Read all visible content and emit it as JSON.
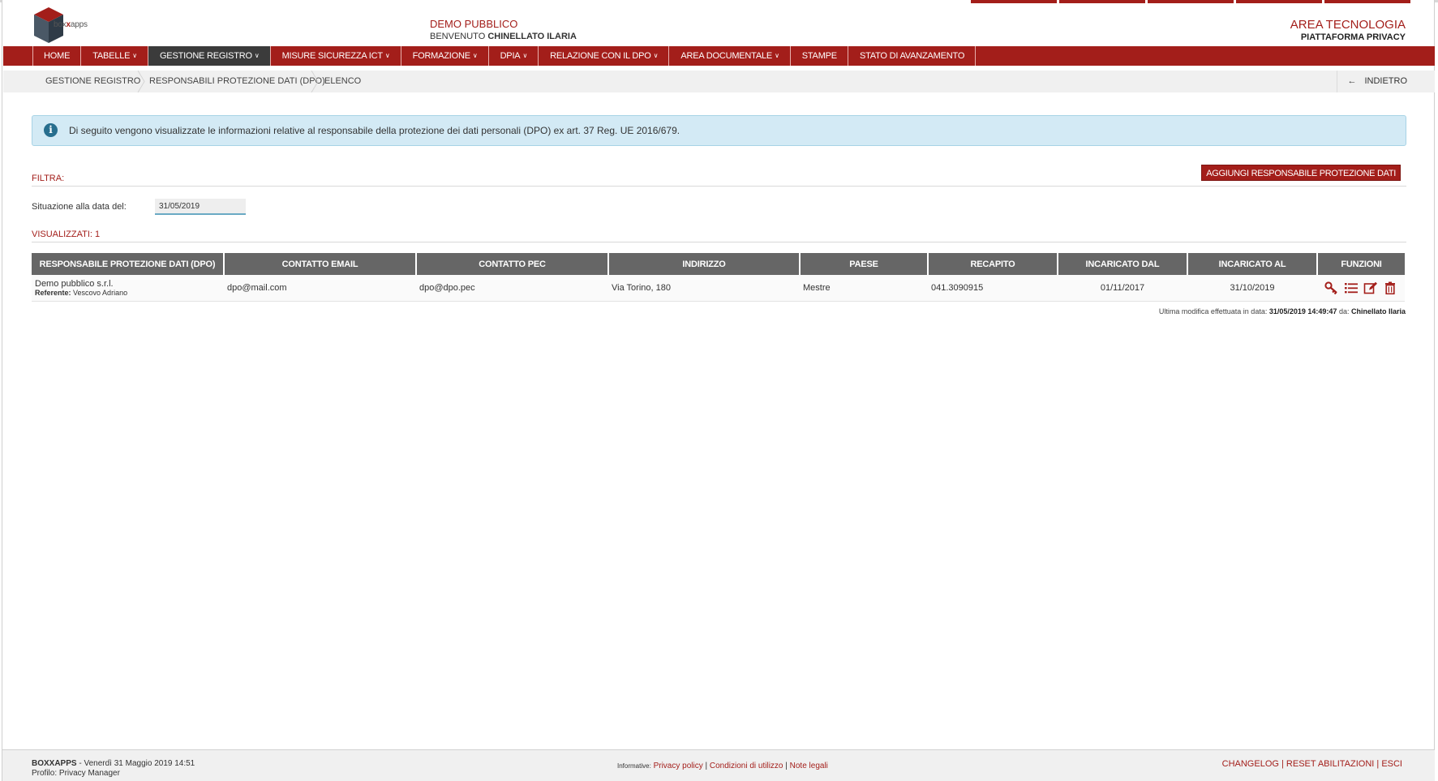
{
  "app": {
    "logo_text_a": "box",
    "logo_text_b": "x",
    "logo_text_c": "apps"
  },
  "header": {
    "org": "DEMO PUBBLICO",
    "welcome_prefix": "BENVENUTO",
    "user": "CHINELLATO ILARIA",
    "area": "AREA TECNOLOGIA",
    "platform": "PIATTAFORMA PRIVACY"
  },
  "nav": {
    "items": [
      {
        "label": "HOME",
        "dropdown": false
      },
      {
        "label": "TABELLE",
        "dropdown": true
      },
      {
        "label": "GESTIONE REGISTRO",
        "dropdown": true,
        "active": true
      },
      {
        "label": "MISURE SICUREZZA ICT",
        "dropdown": true
      },
      {
        "label": "FORMAZIONE",
        "dropdown": true
      },
      {
        "label": "DPIA",
        "dropdown": true
      },
      {
        "label": "RELAZIONE CON IL DPO",
        "dropdown": true
      },
      {
        "label": "AREA DOCUMENTALE",
        "dropdown": true
      },
      {
        "label": "STAMPE",
        "dropdown": false
      },
      {
        "label": "STATO DI AVANZAMENTO",
        "dropdown": false
      }
    ]
  },
  "breadcrumb": {
    "items": [
      "GESTIONE REGISTRO",
      "RESPONSABILI PROTEZIONE DATI (DPO)",
      "ELENCO"
    ],
    "back_label": "INDIETRO"
  },
  "info": {
    "text": "Di seguito vengono visualizzate le informazioni relative al responsabile della protezione dei dati personali (DPO) ex art. 37 Reg. UE 2016/679."
  },
  "filter": {
    "title": "FILTRA:",
    "add_button": "AGGIUNGI RESPONSABILE PROTEZIONE DATI",
    "date_label": "Situazione alla data del:",
    "date_value": "31/05/2019"
  },
  "results": {
    "title": "VISUALIZZATI: 1"
  },
  "table": {
    "columns": [
      "RESPONSABILE PROTEZIONE DATI (DPO)",
      "CONTATTO EMAIL",
      "CONTATTO PEC",
      "INDIRIZZO",
      "PAESE",
      "RECAPITO",
      "INCARICATO DAL",
      "INCARICATO AL",
      "FUNZIONI"
    ],
    "rows": [
      {
        "name": "Demo pubblico s.r.l.",
        "referent_label": "Referente:",
        "referent": "Vescovo Adriano",
        "email": "dpo@mail.com",
        "pec": "dpo@dpo.pec",
        "address": "Via Torino, 180",
        "town": "Mestre",
        "phone": "041.3090915",
        "from": "01/11/2017",
        "to": "31/10/2019"
      }
    ]
  },
  "last_modified": {
    "prefix": "Ultima modifica effettuata in data:",
    "datetime": "31/05/2019 14:49:47",
    "by_label": "da:",
    "by": "Chinellato Ilaria"
  },
  "footer": {
    "brand": "BOXXAPPS",
    "datetime": " - Venerdì 31 Maggio 2019 14:51",
    "profile": "Profilo: Privacy Manager",
    "info_label": "Informative:",
    "privacy": "Privacy policy",
    "terms": "Condizioni di utilizzo",
    "legal": "Note legali",
    "changelog": "CHANGELOG",
    "reset": "RESET ABILITAZIONI",
    "exit": "ESCI"
  },
  "colors": {
    "brand": "#a31e1a",
    "nav_active": "#3b3b3b",
    "table_header": "#666666",
    "info_bg": "#d3eaf5"
  },
  "icons": [
    "logo-cube-icon",
    "info-icon",
    "arrow-left-icon",
    "key-icon",
    "list-icon",
    "edit-icon",
    "trash-icon"
  ]
}
